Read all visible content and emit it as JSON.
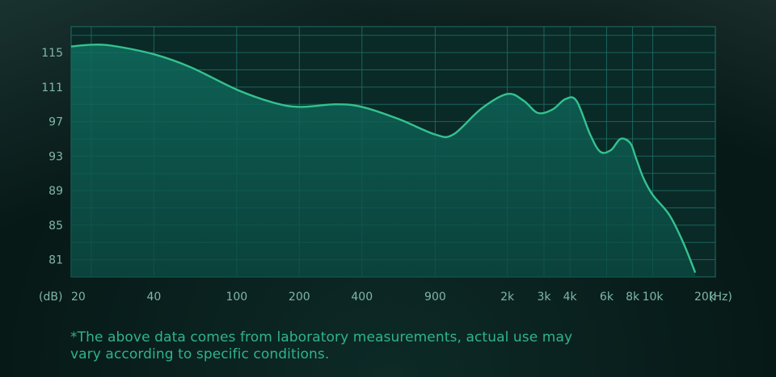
{
  "chart_data": {
    "type": "area",
    "x_scale": "log",
    "xlim": [
      16,
      20000
    ],
    "ylabel": "(dB)",
    "xlabel": "(Hz)",
    "y_ticks": [
      {
        "label": "115",
        "value": 115
      },
      {
        "label": "111",
        "value": 111
      },
      {
        "label": "97",
        "value": 107
      },
      {
        "label": "93",
        "value": 103
      },
      {
        "label": "89",
        "value": 99
      },
      {
        "label": "85",
        "value": 95
      },
      {
        "label": "81",
        "value": 91
      }
    ],
    "ylim": [
      89,
      118
    ],
    "x_ticks": [
      {
        "label": "20",
        "value": 20
      },
      {
        "label": "40",
        "value": 40
      },
      {
        "label": "100",
        "value": 100
      },
      {
        "label": "200",
        "value": 200
      },
      {
        "label": "400",
        "value": 400
      },
      {
        "label": "900",
        "value": 900
      },
      {
        "label": "2k",
        "value": 2000
      },
      {
        "label": "3k",
        "value": 3000
      },
      {
        "label": "4k",
        "value": 4000
      },
      {
        "label": "6k",
        "value": 6000
      },
      {
        "label": "8k",
        "value": 8000
      },
      {
        "label": "10k",
        "value": 10000
      },
      {
        "label": "20k",
        "value": 20000
      }
    ],
    "series": [
      {
        "x": [
          16,
          20,
          25,
          40,
          60,
          100,
          150,
          200,
          300,
          400,
          600,
          900,
          1100,
          1500,
          2000,
          2400,
          2800,
          3300,
          3800,
          4300,
          5000,
          5600,
          6300,
          7000,
          7800,
          8300,
          9000,
          10000,
          12000,
          14000,
          16000
        ],
        "y": [
          115.7,
          115.9,
          115.8,
          114.8,
          113.3,
          110.7,
          109.2,
          108.7,
          109.0,
          108.7,
          107.3,
          105.5,
          105.5,
          108.5,
          110.2,
          109.4,
          108.0,
          108.4,
          109.6,
          109.4,
          105.5,
          103.5,
          103.7,
          105.0,
          104.5,
          102.8,
          100.5,
          98.5,
          96.2,
          93.0,
          89.5
        ]
      }
    ],
    "grid": true,
    "colors": {
      "line": "#35c28f",
      "fill_top": "#0f6b5e",
      "fill_bottom": "#0a4a42",
      "grid": "#1f6f66",
      "plot_bg": "#0a2a27",
      "tick_text": "#7fb7a9"
    }
  },
  "footnote": "*The above data comes from laboratory measurements, actual use may vary according to specific conditions."
}
